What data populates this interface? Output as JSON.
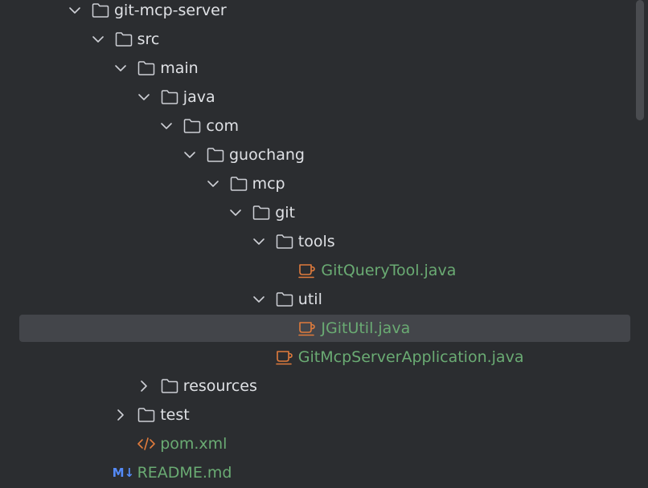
{
  "colors": {
    "background": "#2b2d30",
    "text": "#dfe1e5",
    "file_text_green": "#6aab73",
    "selection": "#43454a",
    "java_icon": "#e07b3c",
    "xml_icon": "#e07b3c",
    "markdown_icon": "#548af7",
    "folder_icon": "#ced0d6",
    "chevron": "#ced0d6"
  },
  "tree": [
    {
      "label": "git-mcp-server",
      "type": "folder",
      "depth": 0,
      "expanded": true
    },
    {
      "label": "src",
      "type": "folder",
      "depth": 1,
      "expanded": true
    },
    {
      "label": "main",
      "type": "folder",
      "depth": 2,
      "expanded": true
    },
    {
      "label": "java",
      "type": "folder",
      "depth": 3,
      "expanded": true
    },
    {
      "label": "com",
      "type": "folder",
      "depth": 4,
      "expanded": true
    },
    {
      "label": "guochang",
      "type": "folder",
      "depth": 5,
      "expanded": true
    },
    {
      "label": "mcp",
      "type": "folder",
      "depth": 6,
      "expanded": true
    },
    {
      "label": "git",
      "type": "folder",
      "depth": 7,
      "expanded": true
    },
    {
      "label": "tools",
      "type": "folder",
      "depth": 8,
      "expanded": true
    },
    {
      "label": "GitQueryTool.java",
      "type": "java",
      "depth": 9
    },
    {
      "label": "util",
      "type": "folder",
      "depth": 8,
      "expanded": true
    },
    {
      "label": "JGitUtil.java",
      "type": "java",
      "depth": 9,
      "selected": true
    },
    {
      "label": "GitMcpServerApplication.java",
      "type": "java",
      "depth": 8
    },
    {
      "label": "resources",
      "type": "folder",
      "depth": 3,
      "expanded": false
    },
    {
      "label": "test",
      "type": "folder",
      "depth": 2,
      "expanded": false
    },
    {
      "label": "pom.xml",
      "type": "xml",
      "depth": 2
    },
    {
      "label": "README.md",
      "type": "md",
      "depth": 1
    }
  ],
  "icons": {
    "folder": "folder-icon",
    "java": "java-class-icon",
    "xml": "xml-file-icon",
    "md": "markdown-file-icon",
    "expanded": "chevron-down-icon",
    "collapsed": "chevron-right-icon"
  },
  "markdown_icon_text": "M↓"
}
